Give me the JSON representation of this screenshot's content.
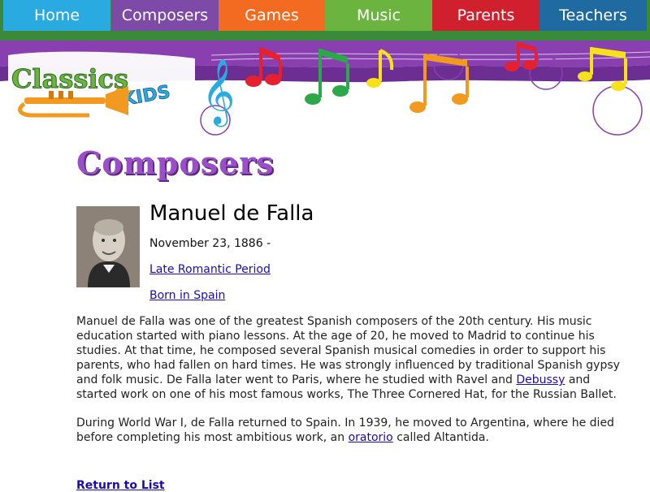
{
  "nav": [
    {
      "label": "Home",
      "color": "#29abe2"
    },
    {
      "label": "Composers",
      "color": "#7d4aa8"
    },
    {
      "label": "Games",
      "color": "#f26b21"
    },
    {
      "label": "Music",
      "color": "#6ab43f"
    },
    {
      "label": "Parents",
      "color": "#d0202e"
    },
    {
      "label": "Teachers",
      "color": "#1f6aa0"
    }
  ],
  "logo": {
    "text": "Classics for Kids"
  },
  "page": {
    "section_title": "Composers"
  },
  "composer": {
    "name": "Manuel de Falla",
    "dates": "November 23, 1886 -",
    "period_link": "Late Romantic Period",
    "born_link": "Born in Spain",
    "p1_a": "Manuel de Falla was one of the greatest Spanish composers of the 20th century. His music education started with piano lessons. At the age of 20, he moved to Madrid to continue his studies. At that time, he composed several Spanish musical comedies in order to support his parents, who had fallen on hard times. He was strongly influenced by traditional Spanish gypsy and folk music. De Falla later went to Paris, where he studied with Ravel and ",
    "p1_link": "Debussy",
    "p1_b": " and started work on one of his most famous works, The Three Cornered Hat, for the Russian Ballet.",
    "p2_a": "During World War I, de Falla returned to Spain. In 1939, he moved to Argentina, where he died before completing his most ambitious work, an ",
    "p2_link": "oratorio",
    "p2_b": " called Altantida."
  },
  "return_link": "Return to List"
}
